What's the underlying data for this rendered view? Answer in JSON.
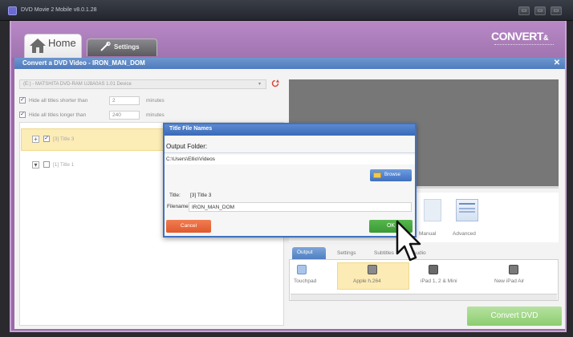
{
  "window": {
    "title": "DVD Movie 2 Mobile v8.0.1.28",
    "controls": [
      "▭",
      "▭",
      "▭"
    ]
  },
  "app": {
    "tabs": {
      "home": "Home",
      "settings": "Settings"
    },
    "brand": "CONVERT",
    "brand_suffix": "&"
  },
  "dialog": {
    "title": "Convert a DVD Video  -  IRON_MAN_DOM",
    "close": "✕",
    "source": {
      "value": "(E:) - MATSHITA DVD-RAM UJ8A0AS 1.01 Device",
      "arrow": "▾"
    },
    "options": [
      {
        "label": "Hide all titles shorter than",
        "value": "2",
        "unit": "minutes"
      },
      {
        "label": "Hide all titles longer than",
        "value": "240",
        "unit": "minutes"
      }
    ],
    "tree": [
      {
        "toggle": "+",
        "label": "[3] Title 3"
      },
      {
        "toggle": "▾",
        "label": "[1] Title 1"
      }
    ]
  },
  "presets": [
    {
      "label": "Manual",
      "icon": "manual-icon"
    },
    {
      "label": "Advanced",
      "icon": "advanced-icon"
    }
  ],
  "settings_tabs": [
    "Output",
    "Settings",
    "Subtitles",
    "Audio"
  ],
  "devices": [
    {
      "label": "Touchpad"
    },
    {
      "label": "Apple h.264"
    },
    {
      "label": "iPad 1, 2 & Mini"
    },
    {
      "label": "New iPad Air"
    }
  ],
  "convert_button": "Convert DVD",
  "popup": {
    "title": "Title File Names",
    "output_folder_label": "Output Folder:",
    "output_folder_value": "C:\\Users\\Ellio\\Videos",
    "browse_label": "Browse",
    "title_key": "Title:",
    "title_value": "[3] Title 3",
    "filename_key": "Filename:",
    "filename_value": "IRON_MAN_DOM",
    "cancel_label": "Cancel",
    "ok_label": "OK"
  },
  "colors": {
    "purple": "#9a6aa8",
    "dialog_blue": "#4f7bbd",
    "ok_green": "#3a9a34",
    "cancel_orange": "#df5a2e",
    "convert_green": "#8ccd70",
    "highlight": "#fcecb6"
  }
}
